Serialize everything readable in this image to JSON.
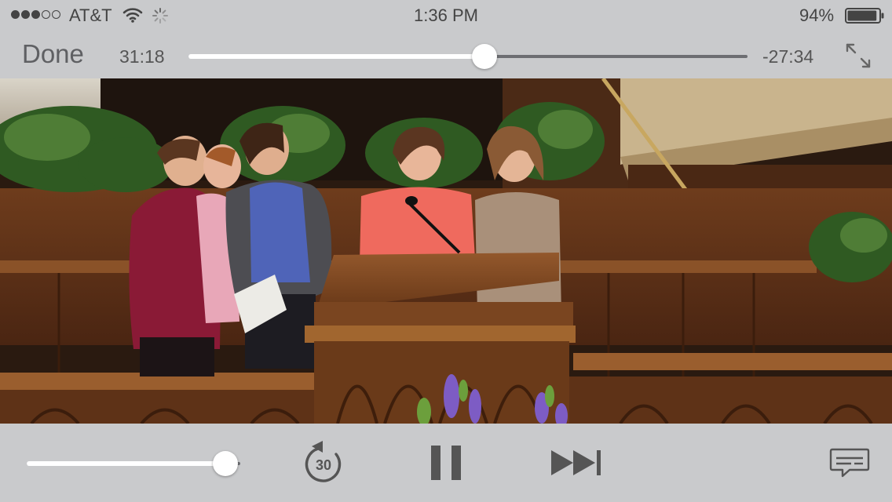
{
  "status_bar": {
    "carrier": "AT&T",
    "signal_strength": 3,
    "signal_max": 5,
    "time": "1:36 PM",
    "battery_percent": "94%",
    "battery_level": 0.94
  },
  "player": {
    "done_label": "Done",
    "elapsed": "31:18",
    "remaining": "-27:34",
    "progress": 0.53,
    "volume": 0.93,
    "skip_back_seconds": "30"
  },
  "icons": {
    "signal": "signal-dots-icon",
    "wifi": "wifi-icon",
    "activity": "activity-spinner-icon",
    "battery": "battery-icon",
    "fullscreen": "expand-arrows-icon",
    "skip_back": "skip-back-30-icon",
    "pause": "pause-icon",
    "next": "next-track-icon",
    "subtitles": "subtitles-speech-bubble-icon"
  },
  "colors": {
    "bar_background": "#c9cacc",
    "control_gray": "#555555",
    "slider_fill": "#ffffff",
    "slider_track": "#6d6e72"
  }
}
